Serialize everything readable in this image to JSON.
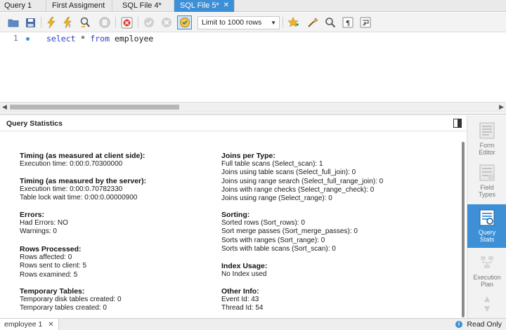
{
  "tabs": [
    {
      "label": "Query 1",
      "active": false
    },
    {
      "label": "First Assigment",
      "active": false
    },
    {
      "label": "SQL File 4*",
      "active": false
    },
    {
      "label": "SQL File 5*",
      "active": true
    }
  ],
  "toolbar": {
    "limit_select_value": "Limit to 1000 rows",
    "icons": [
      "open-folder-icon",
      "save-icon",
      "execute-icon",
      "execute-current-icon",
      "explain-icon",
      "stop-icon",
      "toggle-error-icon",
      "commit-icon",
      "rollback-icon",
      "autocommit-icon",
      "bookmark-star-icon",
      "beautify-icon",
      "find-icon",
      "invisible-chars-icon",
      "wrap-lines-icon"
    ]
  },
  "editor": {
    "line_number": "1",
    "tokens": [
      {
        "text": "select",
        "kind": "kw"
      },
      {
        "text": " * ",
        "kind": "plain"
      },
      {
        "text": "from",
        "kind": "kw"
      },
      {
        "text": " employee",
        "kind": "plain"
      }
    ]
  },
  "panel": {
    "title": "Query Statistics"
  },
  "stats": {
    "left": [
      {
        "heading": "Timing (as measured at client side):",
        "lines": [
          "Execution time: 0:00:0.70300000"
        ]
      },
      {
        "heading": "Timing (as measured by the server):",
        "lines": [
          "Execution time: 0:00:0.70782330",
          "Table lock wait time: 0:00:0.00000900"
        ]
      },
      {
        "heading": "Errors:",
        "lines": [
          "Had Errors: NO",
          "Warnings: 0"
        ]
      },
      {
        "heading": "Rows Processed:",
        "lines": [
          "Rows affected: 0",
          "Rows sent to client: 5",
          "Rows examined: 5"
        ]
      },
      {
        "heading": "Temporary Tables:",
        "lines": [
          "Temporary disk tables created: 0",
          "Temporary tables created: 0"
        ]
      }
    ],
    "right": [
      {
        "heading": "Joins per Type:",
        "lines": [
          "Full table scans (Select_scan): 1",
          "Joins using table scans (Select_full_join): 0",
          "Joins using range search (Select_full_range_join): 0",
          "Joins with range checks (Select_range_check): 0",
          "Joins using range (Select_range): 0"
        ]
      },
      {
        "heading": "Sorting:",
        "lines": [
          "Sorted rows (Sort_rows): 0",
          "Sort merge passes (Sort_merge_passes): 0",
          "Sorts with ranges (Sort_range): 0",
          "Sorts with table scans (Sort_scan): 0"
        ]
      },
      {
        "heading": "Index Usage:",
        "lines": [
          "No Index used"
        ]
      },
      {
        "heading": "Other Info:",
        "lines": [
          "Event Id: 43",
          "Thread Id: 54"
        ]
      }
    ]
  },
  "sidebar": {
    "items": [
      {
        "label1": "Form",
        "label2": "Editor",
        "icon": "form-editor-icon",
        "active": false
      },
      {
        "label1": "Field",
        "label2": "Types",
        "icon": "field-types-icon",
        "active": false
      },
      {
        "label1": "Query",
        "label2": "Stats",
        "icon": "query-stats-icon",
        "active": true
      },
      {
        "label1": "Execution",
        "label2": "Plan",
        "icon": "execution-plan-icon",
        "active": false
      }
    ]
  },
  "statusbar": {
    "result_tab": "employee 1",
    "readonly": "Read Only"
  },
  "colors": {
    "accent": "#3d8fd6",
    "keyword": "#2a40c8"
  }
}
